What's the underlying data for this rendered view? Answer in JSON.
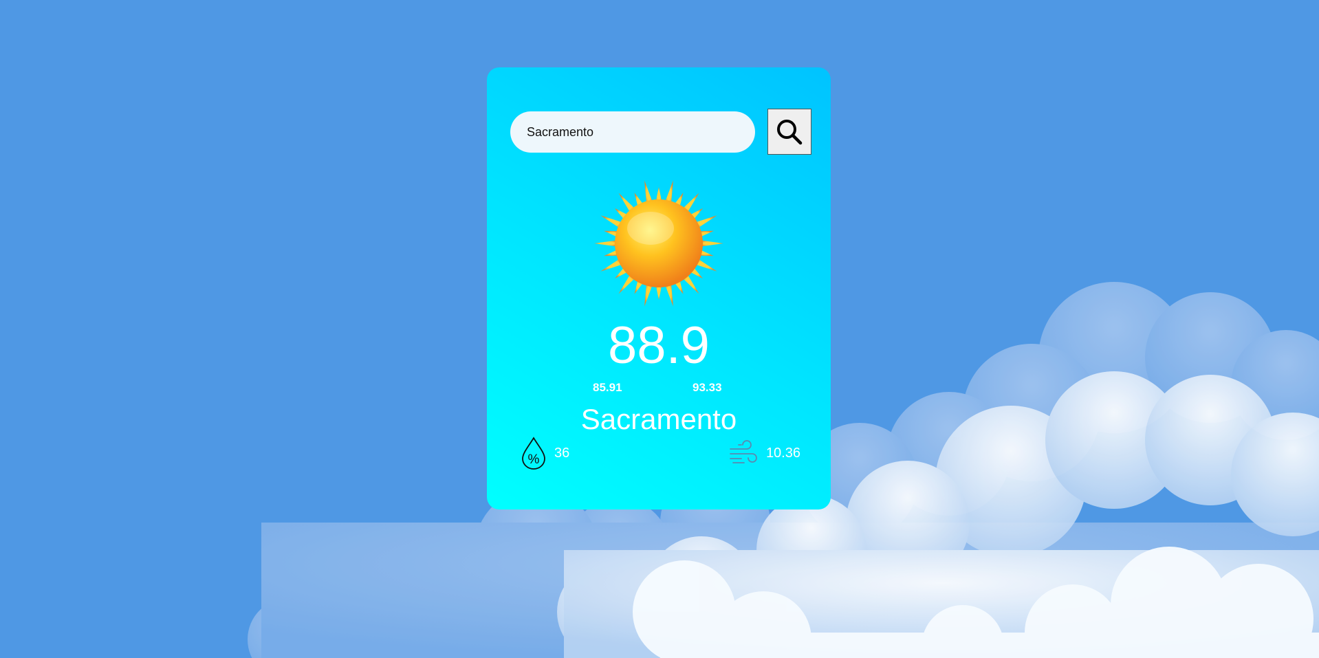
{
  "search": {
    "value": "Sacramento",
    "button_icon": "search-icon"
  },
  "weather": {
    "icon": "sun-icon",
    "temperature": "88.9",
    "temp_min": "85.91",
    "temp_max": "93.33",
    "city": "Sacramento",
    "humidity": "36",
    "humidity_icon": "humidity-drop-icon",
    "wind_speed": "10.36",
    "wind_icon": "wind-icon"
  },
  "colors": {
    "background": "#4f98e4",
    "card_gradient_start": "#00ffff",
    "card_gradient_end": "#00c3ff",
    "text": "#ffffff"
  }
}
